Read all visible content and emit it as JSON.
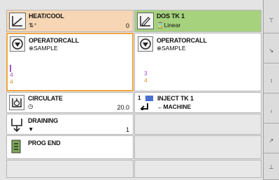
{
  "cells": {
    "heat_cool": {
      "title": "HEAT/COOL",
      "sub": "⇅⁺",
      "value": "0"
    },
    "dos_tk": {
      "title": "DOS TK 1",
      "sub": "⌛Linear"
    },
    "operatorcall_left": {
      "title": "OPERATORCALL",
      "sub": "SAMPLE",
      "n1": "4",
      "n2": "4"
    },
    "operatorcall_right": {
      "title": "OPERATORCALL",
      "sub": "SAMPLE",
      "n1": "3",
      "n2": "4"
    },
    "circulate": {
      "title": "CIRCULATE",
      "value": "20.0"
    },
    "inject_tk": {
      "title": "INJECT TK 1",
      "sub": "←MACHINE",
      "badge": "1"
    },
    "draining": {
      "title": "DRAINING",
      "value": "1"
    },
    "prog_end": {
      "title": "PROG END"
    }
  },
  "sidebar": {
    "buttons": [
      "⊤",
      "↘",
      "↕",
      "↓",
      "↗",
      "⊥"
    ]
  },
  "colors": {
    "selected_border": "#f2a641",
    "heat_cool_bg": "#f2c89c",
    "dos_bg": "#93c86e",
    "purple_num": "#a34fc0",
    "orange_num": "#e39030"
  }
}
